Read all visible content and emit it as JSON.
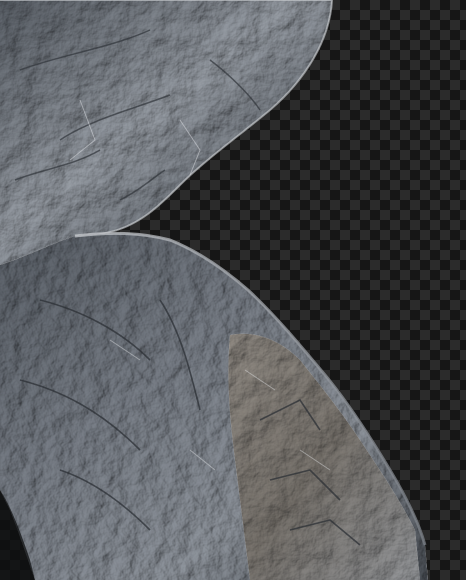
{
  "image": {
    "subject": "rock-texture-cutout",
    "background": "transparency-checkerboard",
    "colors": {
      "rock_light": "#b9bdc3",
      "rock_mid": "#7e848d",
      "rock_dark": "#3f444b",
      "rock_warm": "#8a8278",
      "checker_dark": "#161616",
      "checker_light": "#2b2b2b"
    }
  }
}
